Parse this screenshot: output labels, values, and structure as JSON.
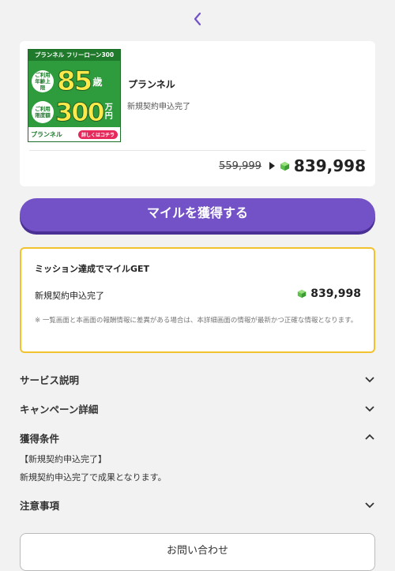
{
  "colors": {
    "accent": "#7352c7",
    "mission_border": "#f2c22e",
    "gem": "#5cc04a",
    "banner_green": "#2e9c3c"
  },
  "header": {
    "back_icon": "chevron-left-icon"
  },
  "offer": {
    "banner": {
      "top_text": "プランネル フリーローン300",
      "row1_badge": "ご利用年齢上限",
      "row1_number": "85",
      "row1_unit": "歳",
      "row2_badge": "ご利用限度額",
      "row2_number": "300",
      "row2_unit": "万円",
      "logo_text": "プランネル",
      "detail_button": "詳しくはコチラ"
    },
    "title": "プランネル",
    "subtitle": "新規契約申込完了",
    "old_price": "559,999",
    "new_price": "839,998"
  },
  "cta": {
    "label": "マイルを獲得する"
  },
  "mission": {
    "title": "ミッション達成でマイルGET",
    "item_label": "新規契約申込完了",
    "item_value": "839,998",
    "note": "※ 一覧画面と本画面の報酬情報に差異がある場合は、本詳細画面の情報が最新かつ正確な情報となります。"
  },
  "sections": [
    {
      "label": "サービス説明",
      "expanded": false
    },
    {
      "label": "キャンペーン詳細",
      "expanded": false
    },
    {
      "label": "獲得条件",
      "expanded": true,
      "body": [
        "【新規契約申込完了】",
        "新規契約申込完了で成果となります。"
      ]
    },
    {
      "label": "注意事項",
      "expanded": false
    }
  ],
  "contact": {
    "label": "お問い合わせ"
  }
}
